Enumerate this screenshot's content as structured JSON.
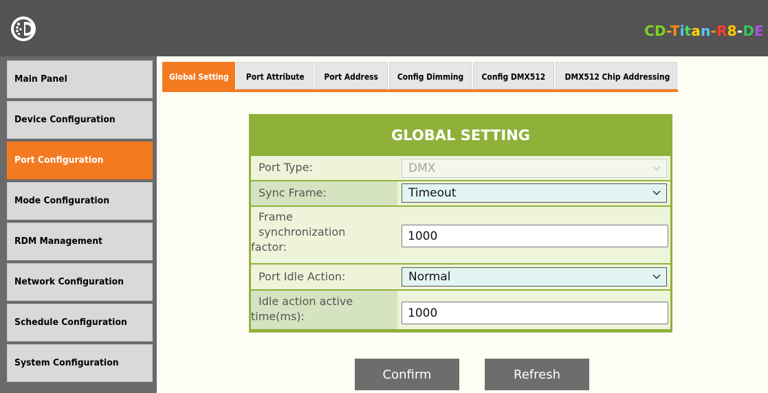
{
  "header": {
    "logo_icon": "cd-logo-icon",
    "device_name_parts": [
      {
        "text": "CD",
        "color": "#7ed321"
      },
      {
        "text": "-",
        "color": "#f5a623"
      },
      {
        "text": "T",
        "color": "#ff8c1a"
      },
      {
        "text": "i",
        "color": "#5ac8fa"
      },
      {
        "text": "t",
        "color": "#4cd964"
      },
      {
        "text": "a",
        "color": "#ffd60a"
      },
      {
        "text": "n",
        "color": "#5ac8fa"
      },
      {
        "text": "-",
        "color": "#ff9500"
      },
      {
        "text": "R",
        "color": "#ff3b30"
      },
      {
        "text": "8",
        "color": "#ffcc00"
      },
      {
        "text": "-",
        "color": "#ffffff"
      },
      {
        "text": "D",
        "color": "#34c759"
      },
      {
        "text": "E",
        "color": "#af52de"
      }
    ]
  },
  "sidebar": {
    "items": [
      {
        "label": "Main Panel",
        "active": false
      },
      {
        "label": "Device Configuration",
        "active": false
      },
      {
        "label": "Port Configuration",
        "active": true
      },
      {
        "label": "Mode Configuration",
        "active": false
      },
      {
        "label": "RDM Management",
        "active": false
      },
      {
        "label": "Network Configuration",
        "active": false
      },
      {
        "label": "Schedule Configuration",
        "active": false
      },
      {
        "label": "System Configuration",
        "active": false
      }
    ]
  },
  "tabs": [
    {
      "label": "Global Setting",
      "active": true
    },
    {
      "label": "Port Attribute",
      "active": false
    },
    {
      "label": "Port Address",
      "active": false
    },
    {
      "label": "Config Dimming",
      "active": false
    },
    {
      "label": "Config DMX512",
      "active": false
    },
    {
      "label": "DMX512 Chip Addressing",
      "active": false
    }
  ],
  "panel": {
    "title": "GLOBAL SETTING",
    "port_type": {
      "label": "Port Type:",
      "value": "DMX",
      "disabled": true
    },
    "sync_frame": {
      "label": "Sync Frame:",
      "value": "Timeout"
    },
    "frame_sync_factor": {
      "label_lines": [
        "Frame",
        "synchronization",
        "factor:"
      ],
      "value": "1000"
    },
    "port_idle_action": {
      "label": "Port Idle Action:",
      "value": "Normal"
    },
    "idle_action_time": {
      "label_lines": [
        "Idle action active",
        "time(ms):"
      ],
      "value": "1000"
    }
  },
  "buttons": {
    "confirm": "Confirm",
    "refresh": "Refresh"
  },
  "colors": {
    "header_bg": "#535353",
    "accent_orange": "#f47a21",
    "panel_green": "#8fb13a",
    "button_gray": "#6d6d6d"
  }
}
